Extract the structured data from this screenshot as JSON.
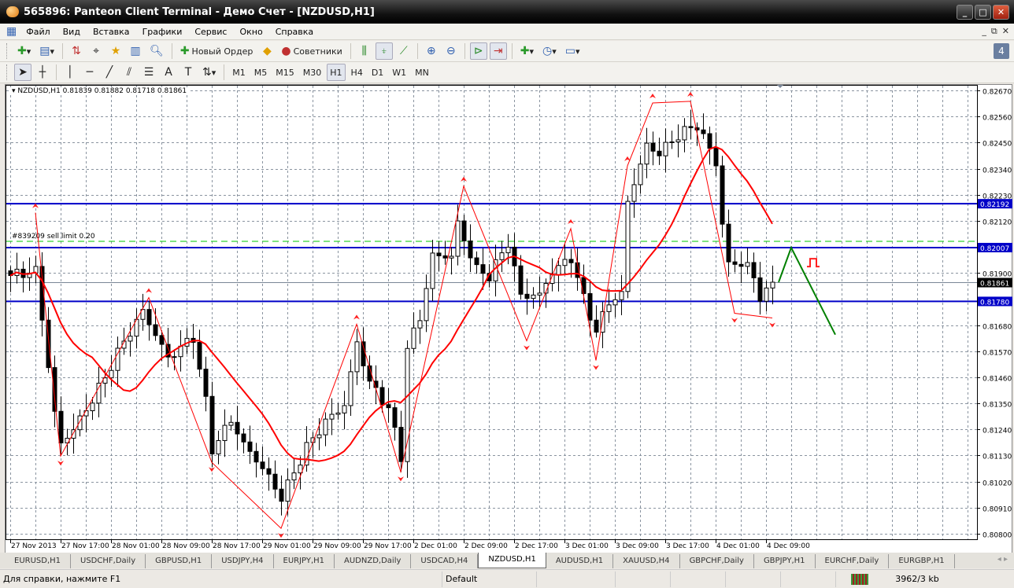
{
  "window": {
    "title": "565896: Panteon Client Terminal - Демо Счет - [NZDUSD,H1]"
  },
  "menu": [
    "Файл",
    "Вид",
    "Вставка",
    "Графики",
    "Сервис",
    "Окно",
    "Справка"
  ],
  "toolbar": {
    "new_order": "Новый Ордер",
    "advisors": "Советники"
  },
  "timeframes": [
    "M1",
    "M5",
    "M15",
    "M30",
    "H1",
    "H4",
    "D1",
    "W1",
    "MN"
  ],
  "active_timeframe": "H1",
  "chart": {
    "header": "NZDUSD,H1  0.81839 0.81882 0.81718 0.81861",
    "order_label": "#839209 sell limit 0.20"
  },
  "chart_data": {
    "type": "candlestick",
    "symbol": "NZDUSD",
    "timeframe": "H1",
    "ylim": [
      0.808,
      0.8267
    ],
    "y_ticks": [
      "0.82670",
      "0.82560",
      "0.82450",
      "0.82340",
      "0.82230",
      "0.82120",
      "0.81900",
      "0.81680",
      "0.81570",
      "0.81460",
      "0.81350",
      "0.81240",
      "0.81130",
      "0.81020",
      "0.80910",
      "0.80800"
    ],
    "x_ticks": [
      {
        "bar": 0,
        "label": "27 Nov 2013"
      },
      {
        "bar": 8,
        "label": "27 Nov 17:00"
      },
      {
        "bar": 16,
        "label": "28 Nov 01:00"
      },
      {
        "bar": 24,
        "label": "28 Nov 09:00"
      },
      {
        "bar": 32,
        "label": "28 Nov 17:00"
      },
      {
        "bar": 40,
        "label": "29 Nov 01:00"
      },
      {
        "bar": 48,
        "label": "29 Nov 09:00"
      },
      {
        "bar": 56,
        "label": "29 Nov 17:00"
      },
      {
        "bar": 64,
        "label": "2 Dec 01:00"
      },
      {
        "bar": 72,
        "label": "2 Dec 09:00"
      },
      {
        "bar": 80,
        "label": "2 Dec 17:00"
      },
      {
        "bar": 88,
        "label": "3 Dec 01:00"
      },
      {
        "bar": 96,
        "label": "3 Dec 09:00"
      },
      {
        "bar": 104,
        "label": "3 Dec 17:00"
      },
      {
        "bar": 112,
        "label": "4 Dec 01:00"
      },
      {
        "bar": 120,
        "label": "4 Dec 09:00"
      }
    ],
    "close_path": [
      [
        0,
        0.81889
      ],
      [
        4,
        0.81922
      ],
      [
        5,
        0.81723
      ],
      [
        7,
        0.81326
      ],
      [
        8,
        0.81194
      ],
      [
        11,
        0.81293
      ],
      [
        15,
        0.81459
      ],
      [
        17,
        0.81558
      ],
      [
        21,
        0.81723
      ],
      [
        25,
        0.81525
      ],
      [
        29,
        0.81624
      ],
      [
        31,
        0.81359
      ],
      [
        32,
        0.81161
      ],
      [
        35,
        0.81293
      ],
      [
        37,
        0.81194
      ],
      [
        40,
        0.81094
      ],
      [
        43,
        0.80962
      ],
      [
        45,
        0.81061
      ],
      [
        47,
        0.81161
      ],
      [
        50,
        0.8126
      ],
      [
        53,
        0.81326
      ],
      [
        55,
        0.81591
      ],
      [
        57,
        0.81425
      ],
      [
        60,
        0.81326
      ],
      [
        62,
        0.81128
      ],
      [
        63,
        0.81591
      ],
      [
        65,
        0.81723
      ],
      [
        67,
        0.81988
      ],
      [
        70,
        0.81988
      ],
      [
        71,
        0.82121
      ],
      [
        74,
        0.81922
      ],
      [
        76,
        0.81889
      ],
      [
        79,
        0.82021
      ],
      [
        81,
        0.8179
      ],
      [
        84,
        0.8179
      ],
      [
        86,
        0.81889
      ],
      [
        89,
        0.81955
      ],
      [
        91,
        0.8179
      ],
      [
        93,
        0.81657
      ],
      [
        95,
        0.8179
      ],
      [
        97,
        0.81823
      ],
      [
        98,
        0.8222
      ],
      [
        101,
        0.82452
      ],
      [
        103,
        0.82418
      ],
      [
        106,
        0.82485
      ],
      [
        109,
        0.82518
      ],
      [
        112,
        0.82352
      ],
      [
        113,
        0.82087
      ],
      [
        114,
        0.81922
      ],
      [
        117,
        0.81922
      ],
      [
        119,
        0.8179
      ],
      [
        121,
        0.81861
      ]
    ],
    "zigzag": [
      [
        4,
        0.82154
      ],
      [
        8,
        0.81128
      ],
      [
        22,
        0.81796
      ],
      [
        32,
        0.81101
      ],
      [
        43,
        0.80823
      ],
      [
        55,
        0.81684
      ],
      [
        62,
        0.81061
      ],
      [
        72,
        0.82266
      ],
      [
        82,
        0.81614
      ],
      [
        89,
        0.82087
      ],
      [
        93,
        0.81531
      ],
      [
        98,
        0.82352
      ],
      [
        102,
        0.82617
      ],
      [
        108,
        0.82624
      ],
      [
        115,
        0.8173
      ],
      [
        121,
        0.8171
      ]
    ],
    "levels": [
      {
        "price": "0.82192",
        "color": "#0000c8"
      },
      {
        "price": "0.82007",
        "color": "#0000c8"
      },
      {
        "price": "0.81780",
        "color": "#0000c8"
      }
    ],
    "order_line": 0.82035,
    "current_price": "0.81861",
    "forecast": [
      [
        122,
        0.81861
      ],
      [
        124,
        0.82007
      ],
      [
        131,
        0.8164
      ]
    ],
    "ma_period": 14,
    "colors": {
      "ma": "#ff0000",
      "zigzag": "#ff0000",
      "forecast": "#008000",
      "level": "#0000c8",
      "order": "#00c800"
    }
  },
  "tabs": [
    "EURUSD,H1",
    "USDCHF,Daily",
    "GBPUSD,H1",
    "USDJPY,H4",
    "EURJPY,H1",
    "AUDNZD,Daily",
    "USDCAD,H4",
    "NZDUSD,H1",
    "AUDUSD,H1",
    "XAUUSD,H4",
    "GBPCHF,Daily",
    "GBPJPY,H1",
    "EURCHF,Daily",
    "EURGBP,H1"
  ],
  "active_tab": "NZDUSD,H1",
  "status": {
    "help": "Для справки, нажмите F1",
    "profile": "Default",
    "traffic": "3962/3 kb"
  }
}
